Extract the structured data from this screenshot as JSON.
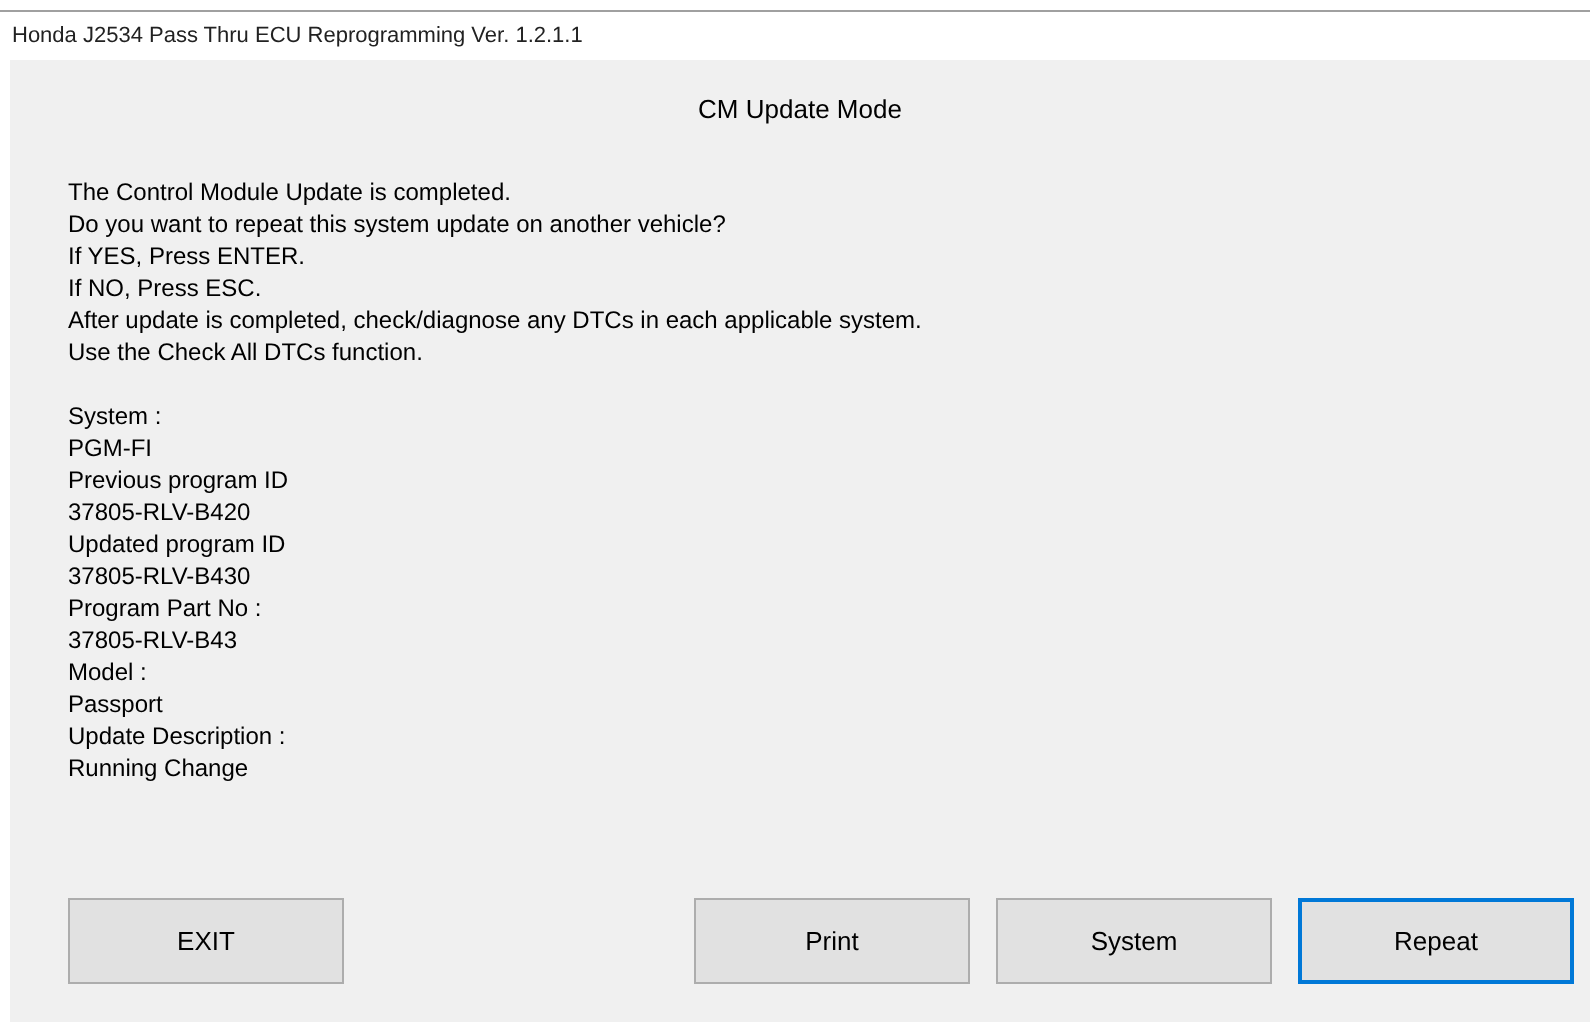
{
  "window": {
    "title": "Honda J2534 Pass Thru ECU Reprogramming Ver. 1.2.1.1"
  },
  "heading": "CM Update Mode",
  "message_lines": [
    "The Control Module Update is completed.",
    "Do you want to repeat this system update on another vehicle?",
    "If YES, Press ENTER.",
    "If NO, Press ESC.",
    "After update is completed, check/diagnose any DTCs in each applicable system.",
    "Use the Check All DTCs function."
  ],
  "detail_lines": [
    "System :",
    "PGM-FI",
    "Previous program ID",
    "37805-RLV-B420",
    "Updated program ID",
    "37805-RLV-B430",
    "Program Part No :",
    "37805-RLV-B43",
    "Model :",
    "Passport",
    "Update Description :",
    "Running Change"
  ],
  "buttons": [
    {
      "label": "EXIT",
      "focused": false
    },
    {
      "label": "Print",
      "focused": false
    },
    {
      "label": "System",
      "focused": false
    },
    {
      "label": "Repeat",
      "focused": true
    }
  ]
}
